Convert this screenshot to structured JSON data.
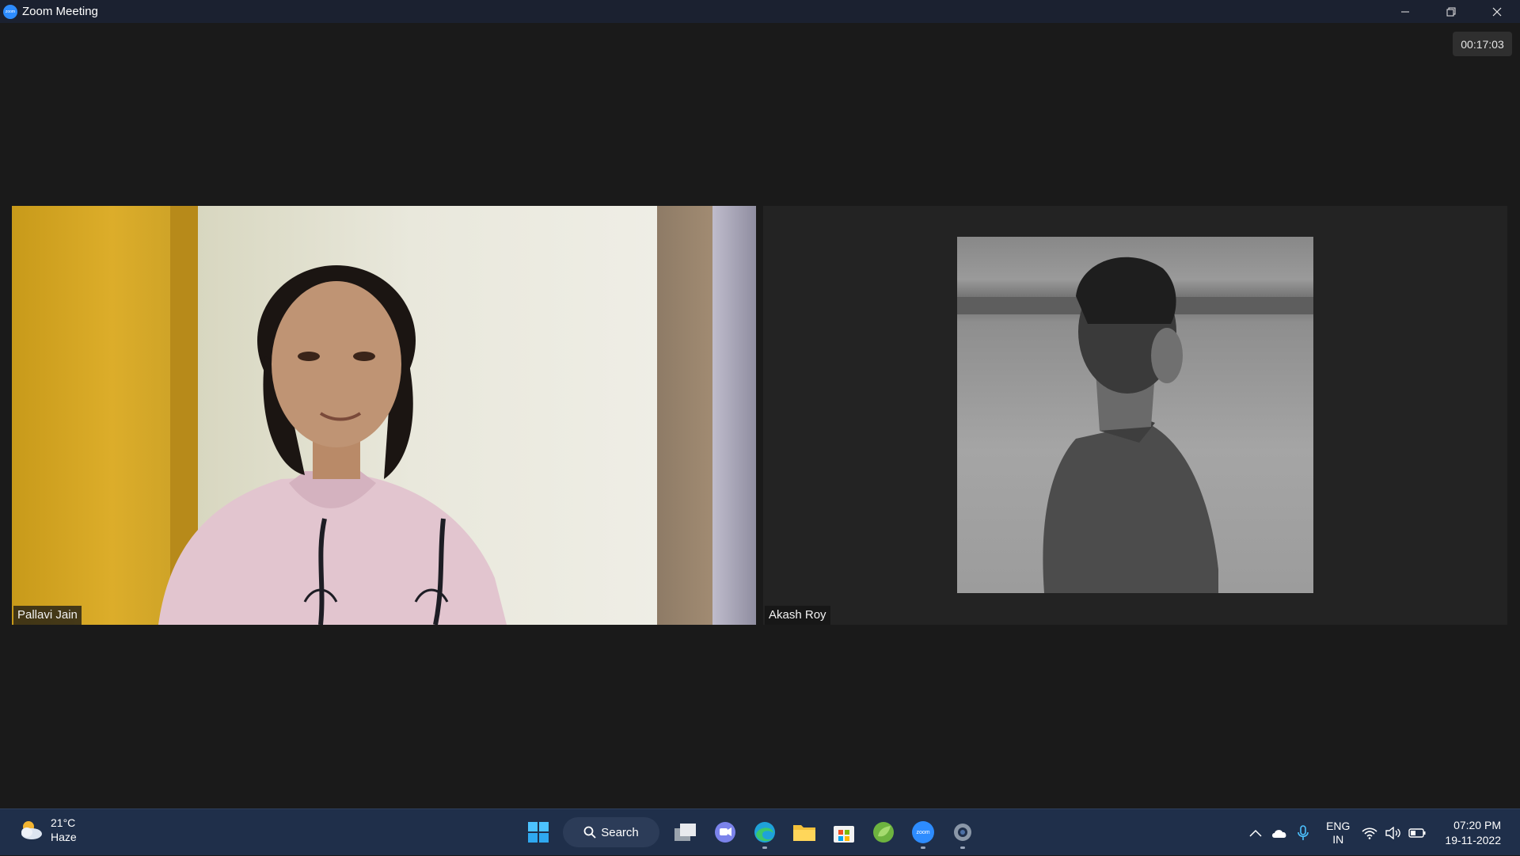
{
  "window": {
    "title": "Zoom Meeting",
    "app_icon_text": "zoom"
  },
  "meeting": {
    "elapsed_time": "00:17:03",
    "participants": [
      {
        "name": "Pallavi Jain"
      },
      {
        "name": "Akash  Roy"
      }
    ]
  },
  "taskbar": {
    "weather": {
      "temperature": "21°C",
      "condition": "Haze"
    },
    "search_label": "Search",
    "apps": [
      "start-icon",
      "task-view-icon",
      "teams-chat-icon",
      "edge-icon",
      "file-explorer-icon",
      "microsoft-store-icon",
      "spring-icon",
      "zoom-icon",
      "settings-icon"
    ],
    "zoom_icon_text": "zoom",
    "language": {
      "line1": "ENG",
      "line2": "IN"
    },
    "clock": {
      "time": "07:20 PM",
      "date": "19-11-2022"
    }
  },
  "colors": {
    "titlebar": "#1b2130",
    "meeting_bg": "#1a1a1a",
    "taskbar": "#1f2f4a",
    "zoom_blue": "#2d8cff"
  }
}
